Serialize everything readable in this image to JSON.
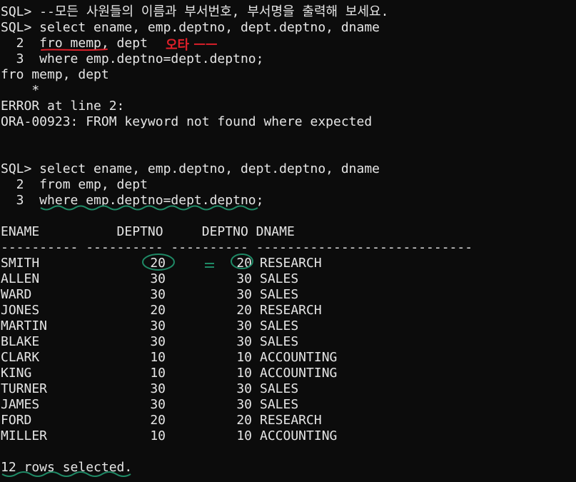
{
  "terminal": {
    "lines": [
      "SQL> --모든 사원들의 이름과 부서번호, 부서명을 출력해 보세요.",
      "SQL> select ename, emp.deptno, dept.deptno, dname",
      "  2  fro memp, dept",
      "  3  where emp.deptno=dept.deptno;",
      "fro memp, dept",
      "    *",
      "ERROR at line 2:",
      "ORA-00923: FROM keyword not found where expected",
      "",
      "",
      "SQL> select ename, emp.deptno, dept.deptno, dname",
      "  2  from emp, dept",
      "  3  where emp.deptno=dept.deptno;",
      "",
      "ENAME          DEPTNO     DEPTNO DNAME",
      "---------- ---------- ---------- ----------------------------"
    ],
    "rows": [
      {
        "ename": "SMITH",
        "emp_deptno": "20",
        "dept_deptno": "20",
        "dname": "RESEARCH"
      },
      {
        "ename": "ALLEN",
        "emp_deptno": "30",
        "dept_deptno": "30",
        "dname": "SALES"
      },
      {
        "ename": "WARD",
        "emp_deptno": "30",
        "dept_deptno": "30",
        "dname": "SALES"
      },
      {
        "ename": "JONES",
        "emp_deptno": "20",
        "dept_deptno": "20",
        "dname": "RESEARCH"
      },
      {
        "ename": "MARTIN",
        "emp_deptno": "30",
        "dept_deptno": "30",
        "dname": "SALES"
      },
      {
        "ename": "BLAKE",
        "emp_deptno": "30",
        "dept_deptno": "30",
        "dname": "SALES"
      },
      {
        "ename": "CLARK",
        "emp_deptno": "10",
        "dept_deptno": "10",
        "dname": "ACCOUNTING"
      },
      {
        "ename": "KING",
        "emp_deptno": "10",
        "dept_deptno": "10",
        "dname": "ACCOUNTING"
      },
      {
        "ename": "TURNER",
        "emp_deptno": "30",
        "dept_deptno": "30",
        "dname": "SALES"
      },
      {
        "ename": "JAMES",
        "emp_deptno": "30",
        "dept_deptno": "30",
        "dname": "SALES"
      },
      {
        "ename": "FORD",
        "emp_deptno": "20",
        "dept_deptno": "20",
        "dname": "RESEARCH"
      },
      {
        "ename": "MILLER",
        "emp_deptno": "10",
        "dept_deptno": "10",
        "dname": "ACCOUNTING"
      }
    ],
    "footer": "12 rows selected."
  },
  "annotations": {
    "typo_note": "오타 ㅡㅡ",
    "equals_mark": "=",
    "red_color": "#e0202a",
    "green_color": "#1f8a66"
  },
  "colors": {
    "background": "#0c0c0c",
    "text": "#e6e6e6"
  }
}
